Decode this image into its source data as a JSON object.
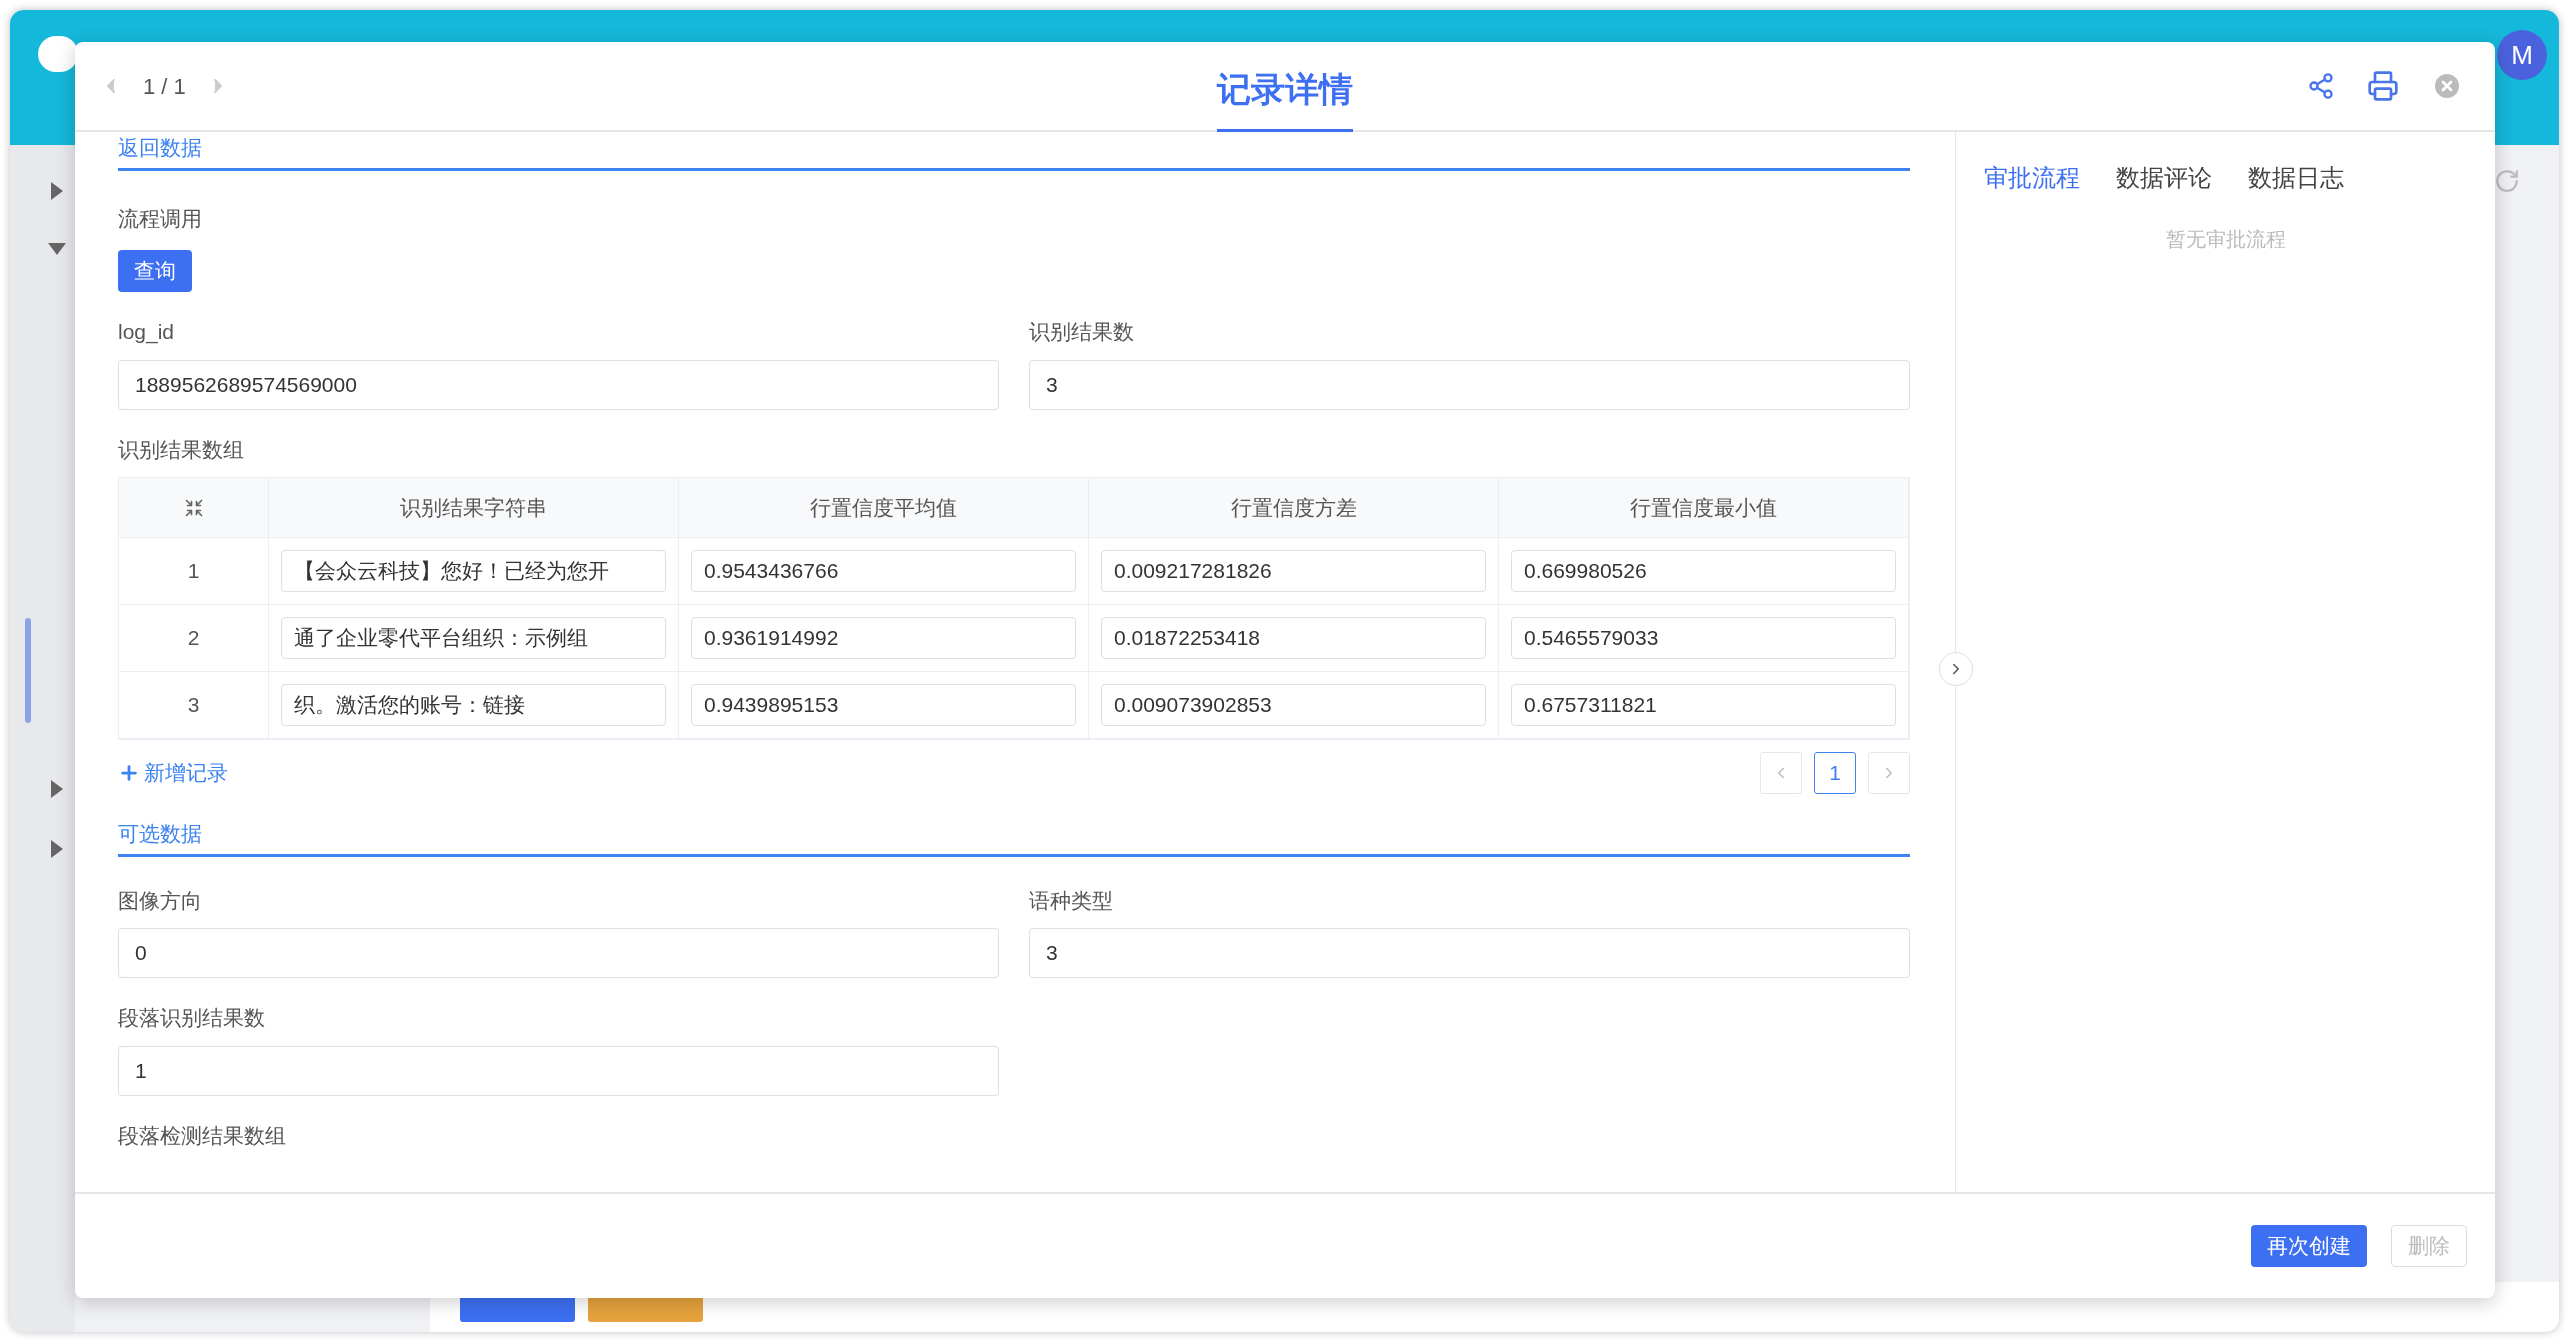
{
  "background": {
    "avatar": "M"
  },
  "modal": {
    "pager": "1 / 1",
    "title": "记录详情"
  },
  "sections": [
    {
      "kind": "table_section",
      "title": "返回数据",
      "process_label": "流程调用",
      "process_button": "查询",
      "fields": [
        {
          "label": "log_id",
          "value": "1889562689574569000"
        },
        {
          "label": "识别结果数",
          "value": "3"
        }
      ],
      "table_label": "识别结果数组",
      "columns": [
        "识别结果字符串",
        "行置信度平均值",
        "行置信度方差",
        "行置信度最小值"
      ],
      "rows": [
        {
          "index": "1",
          "cells": [
            "【会众云科技】您好！已经为您开",
            "0.9543436766",
            "0.009217281826",
            "0.669980526"
          ]
        },
        {
          "index": "2",
          "cells": [
            "通了企业零代平台组织：示例组",
            "0.9361914992",
            "0.01872253418",
            "0.5465579033"
          ]
        },
        {
          "index": "3",
          "cells": [
            "织。激活您的账号：链接",
            "0.9439895153",
            "0.009073902853",
            "0.6757311821"
          ]
        }
      ],
      "add_record": "新增记录",
      "pages": [
        {
          "label": "1",
          "selected": true
        }
      ]
    },
    {
      "kind": "fields_section",
      "title": "可选数据",
      "fields": [
        {
          "label": "图像方向",
          "value": "0"
        },
        {
          "label": "语种类型",
          "value": "3"
        },
        {
          "label": "段落识别结果数",
          "value": "1"
        }
      ],
      "trailing_label": "段落检测结果数组"
    }
  ],
  "side_tabs": [
    {
      "label": "审批流程",
      "selected": true
    },
    {
      "label": "数据评论",
      "selected": false
    },
    {
      "label": "数据日志",
      "selected": false
    }
  ],
  "side_empty": "暂无审批流程",
  "footer": {
    "buttons": [
      {
        "label": "再次创建",
        "disabled": false
      },
      {
        "label": "删除",
        "disabled": true
      }
    ]
  }
}
